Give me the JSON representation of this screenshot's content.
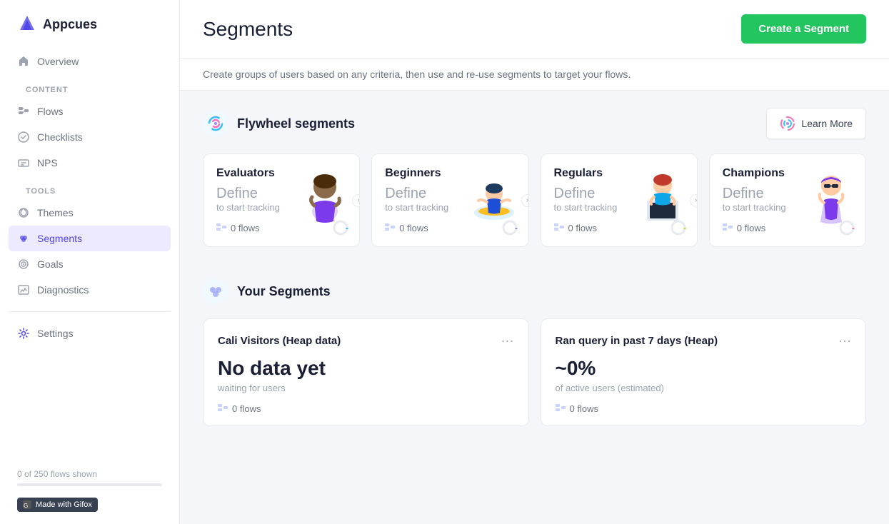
{
  "app": {
    "logo_text": "Appcues"
  },
  "sidebar": {
    "overview_label": "Overview",
    "content_section_label": "CONTENT",
    "tools_section_label": "TOOLS",
    "items_content": [
      {
        "id": "flows",
        "label": "Flows",
        "icon": "flows-icon"
      },
      {
        "id": "checklists",
        "label": "Checklists",
        "icon": "checklists-icon"
      },
      {
        "id": "nps",
        "label": "NPS",
        "icon": "nps-icon"
      }
    ],
    "items_tools": [
      {
        "id": "themes",
        "label": "Themes",
        "icon": "themes-icon"
      },
      {
        "id": "segments",
        "label": "Segments",
        "icon": "segments-icon",
        "active": true
      },
      {
        "id": "goals",
        "label": "Goals",
        "icon": "goals-icon"
      },
      {
        "id": "diagnostics",
        "label": "Diagnostics",
        "icon": "diagnostics-icon"
      }
    ],
    "settings_label": "Settings",
    "flows_shown": "0 of 250 flows shown"
  },
  "header": {
    "title": "Segments",
    "create_button": "Create a Segment"
  },
  "info_bar": {
    "text": "Create groups of users based on any criteria, then use and re-use segments to target your flows."
  },
  "flywheel": {
    "section_title": "Flywheel segments",
    "learn_more": "Learn More",
    "cards": [
      {
        "id": "evaluators",
        "name": "Evaluators",
        "define": "Define",
        "tracking": "to start tracking",
        "flows": "0 flows",
        "emoji": "🧍‍♀️"
      },
      {
        "id": "beginners",
        "name": "Beginners",
        "define": "Define",
        "tracking": "to start tracking",
        "flows": "0 flows",
        "emoji": "🏄"
      },
      {
        "id": "regulars",
        "name": "Regulars",
        "define": "Define",
        "tracking": "to start tracking",
        "flows": "0 flows",
        "emoji": "💼"
      },
      {
        "id": "champions",
        "name": "Champions",
        "define": "Define",
        "tracking": "to start tracking",
        "flows": "0 flows",
        "emoji": "🦸"
      }
    ]
  },
  "your_segments": {
    "section_title": "Your Segments",
    "cards": [
      {
        "id": "cali-visitors",
        "name": "Cali Visitors (Heap data)",
        "stat": "No data yet",
        "stat_label": "waiting for users",
        "flows": "0 flows"
      },
      {
        "id": "ran-query",
        "name": "Ran query in past 7 days (Heap)",
        "stat": "~0%",
        "stat_label": "of active users (estimated)",
        "flows": "0 flows"
      }
    ]
  },
  "made_with": "Made with Gifox"
}
